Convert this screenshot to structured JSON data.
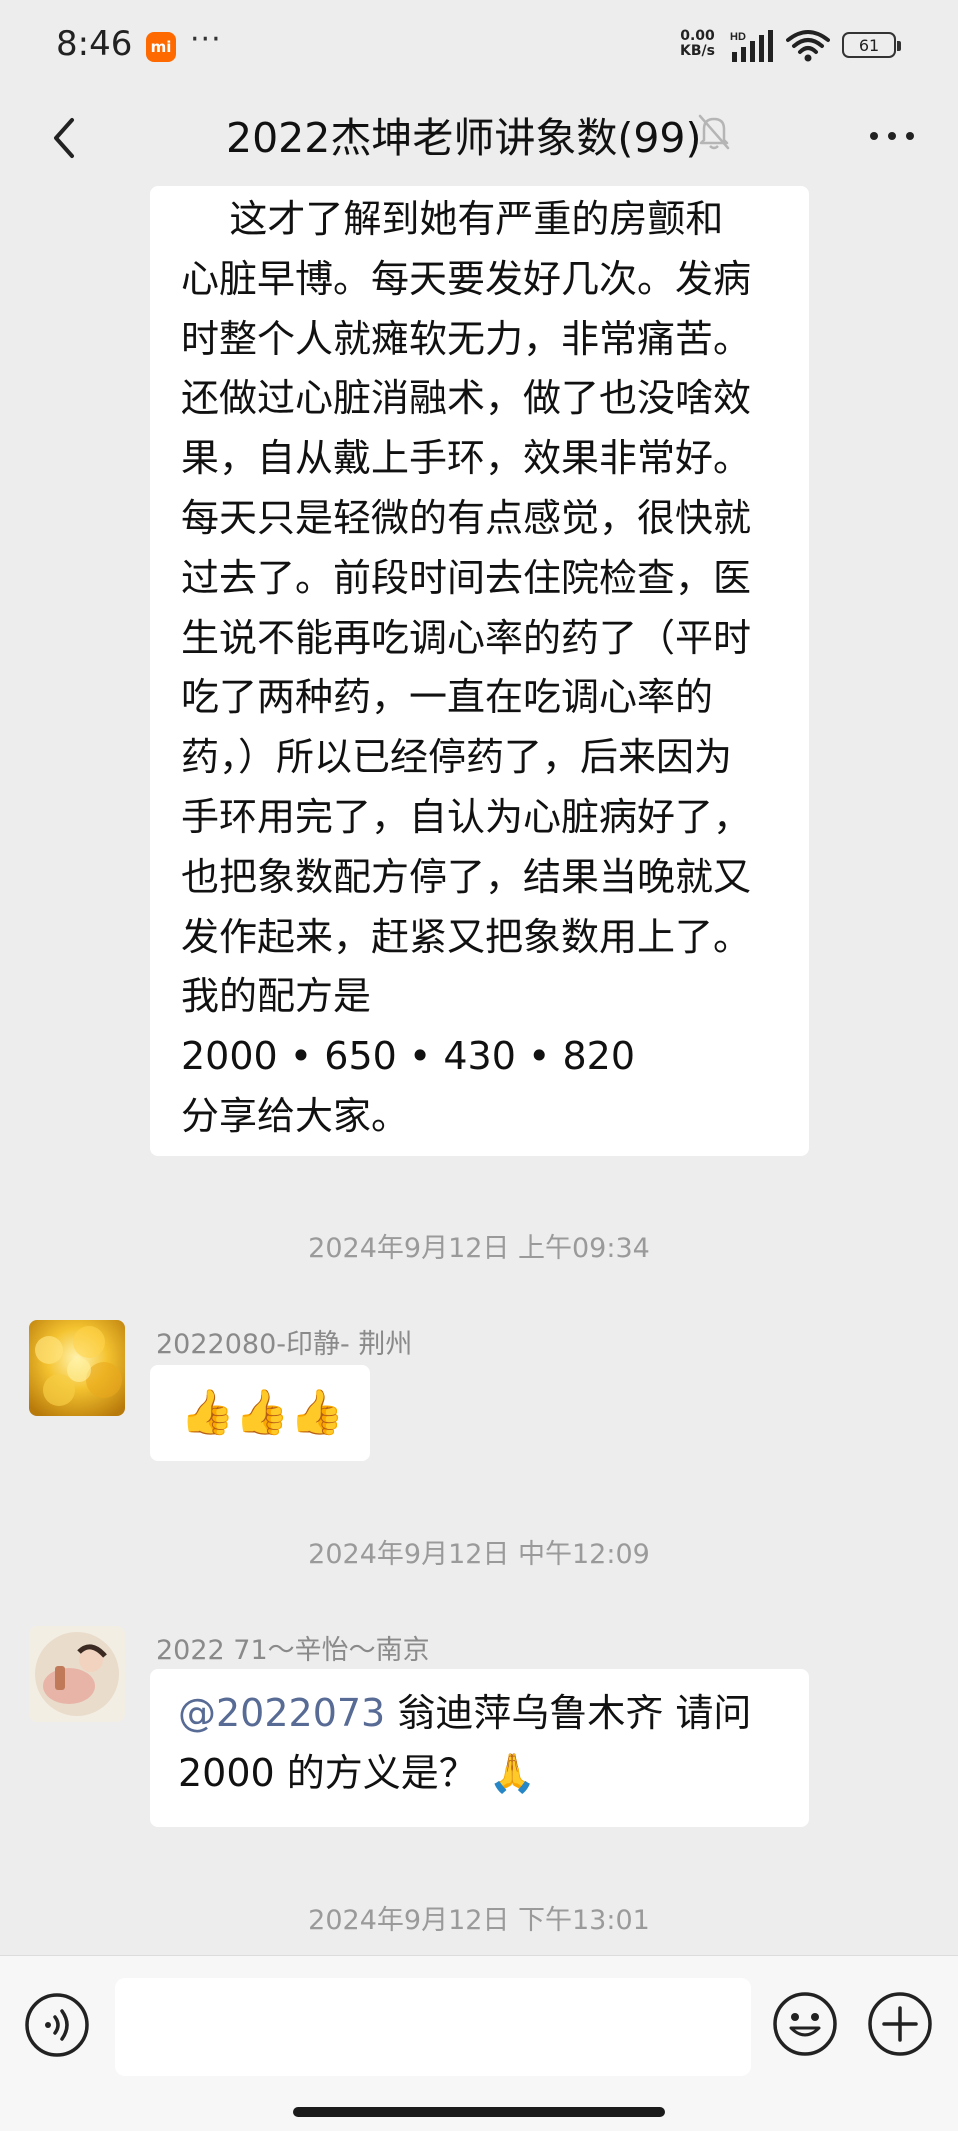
{
  "status_bar": {
    "time": "8:46",
    "mi_badge": "mi",
    "more_dots": "···",
    "net_speed_value": "0.00",
    "net_speed_unit": "KB/s",
    "network_label": "HD",
    "battery": "61"
  },
  "header": {
    "title": "2022杰坤老师讲象数(99)",
    "icons": [
      "back-icon",
      "mute-bell-icon",
      "more-icon"
    ]
  },
  "messages": {
    "first": {
      "lines": [
        "    这才了解到她有严重的房颤和",
        "心脏早博。每天要发好几次。发病",
        "时整个人就瘫软无力，非常痛苦。",
        "还做过心脏消融术，做了也没啥效",
        "果，自从戴上手环，效果非常好。",
        "每天只是轻微的有点感觉，很快就",
        "过去了。前段时间去住院检查，医",
        "生说不能再吃调心率的药了（平时",
        "吃了两种药，一直在吃调心率的",
        "药，）所以已经停药了，后来因为",
        "手环用完了，自认为心脏病好了，",
        "也把象数配方停了，结果当晚就又",
        "发作起来，赶紧又把象数用上了。",
        "我的配方是",
        "2000 • 650 • 430 • 820",
        "分享给大家。"
      ]
    },
    "timestamp_1": "2024年9月12日 上午09:34",
    "second": {
      "sender": "2022080-印静- 荆州",
      "content": "👍👍👍"
    },
    "timestamp_2": "2024年9月12日 中午12:09",
    "third": {
      "sender": "2022 71～辛怡～南京",
      "mention": "@2022073",
      "line1_rest": " 翁迪萍乌鲁木齐  请问",
      "line2": "2000 的方义是？ 🙏"
    },
    "timestamp_3": "2024年9月12日 下午13:01"
  },
  "input_bar": {
    "input_value": "",
    "icons": [
      "voice-icon",
      "emoji-icon",
      "plus-icon"
    ]
  },
  "colors": {
    "background": "#ededed",
    "bubble": "#ffffff",
    "mention": "#576b95",
    "timestamp": "#9a9a9a",
    "mi_badge": "#ff6a00"
  }
}
